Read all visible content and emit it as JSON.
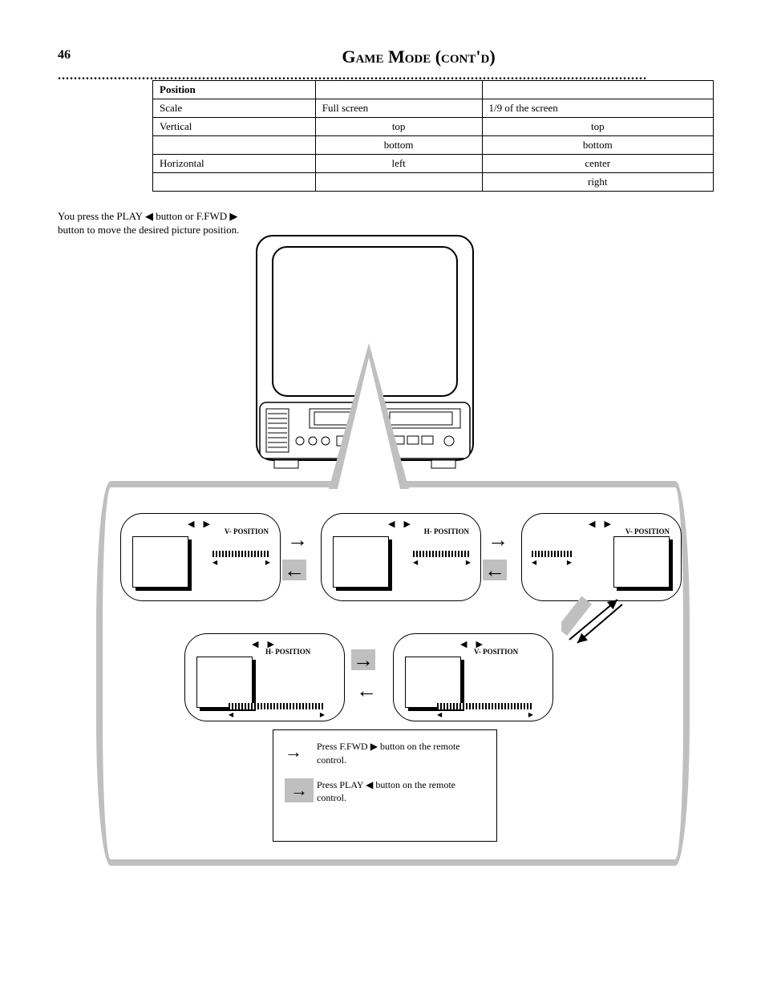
{
  "page": {
    "number": "46",
    "title": "Game Mode (cont'd)",
    "dots": "..................................................................................................................................................."
  },
  "table": {
    "h1": "Position",
    "h2": "",
    "h3": "",
    "r1c1": "Scale",
    "r1c2": "Full screen",
    "r1c3": "1/9 of the screen",
    "r2c1": "Vertical",
    "r2c2": "top",
    "r2c3": "top",
    "r3c1": "",
    "r3c2": "bottom",
    "r3c3": "bottom",
    "r4c1": "Horizontal",
    "r4c2": "left",
    "r4c3": "center",
    "r5c1": "",
    "r5c2": "",
    "r5c3": "right"
  },
  "left": {
    "p1a": "You press the PLAY ",
    "p1b": " button or F.FWD ",
    "p1c": " button to move the desired picture position."
  },
  "cells": {
    "c1": "V- POSITION",
    "c2": "H- POSITION",
    "c3": "V- POSITION",
    "c4": "H- POSITION",
    "c5": "V- POSITION"
  },
  "legend": {
    "title": "",
    "line1a": "Press F.FWD ",
    "line1b": " button on the remote control.",
    "line2a": "Press PLAY ",
    "line2b": " button on the remote control."
  },
  "arrows": {
    "tri_left": "◀",
    "tri_right": "▶",
    "tris": "◀ ▶",
    "right": "→",
    "left": "←",
    "barrow_l": "◀",
    "barrow_r": "▶"
  }
}
